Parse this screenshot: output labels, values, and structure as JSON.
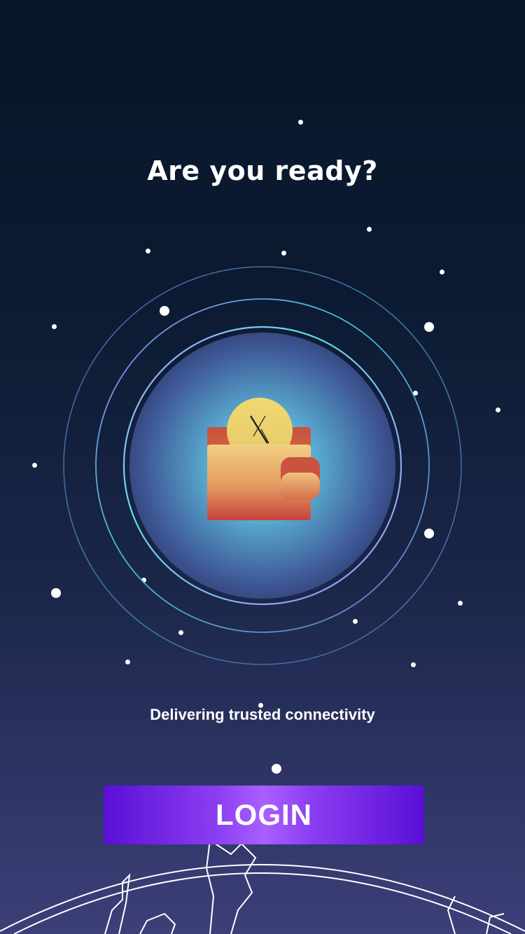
{
  "screen": {
    "title": "Are you ready?",
    "subtitle": "Delivering trusted connectivity",
    "login_label": "LOGIN",
    "coin_glyph": "X"
  },
  "icons": {
    "hero": "wallet-icon",
    "coin": "coin-icon",
    "globe": "globe-icon"
  },
  "colors": {
    "background_top": "#07172a",
    "background_bottom": "#3d3f78",
    "button_accent": "#8a3df0",
    "orbit_inner": "#a98bff",
    "orbit_outer": "#4a6fa8",
    "wallet_top": "#f0c27a",
    "wallet_bottom": "#c8493a",
    "coin": "#e8d27a"
  }
}
